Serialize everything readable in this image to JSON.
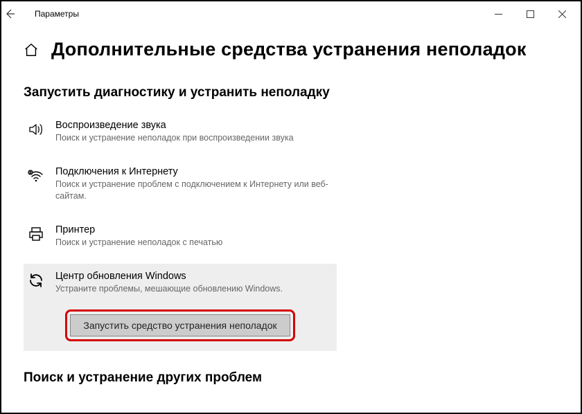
{
  "titlebar": {
    "title": "Параметры"
  },
  "page": {
    "heading": "Дополнительные средства устранения неполадок"
  },
  "sections": {
    "run_diag": "Запустить диагностику и устранить неполадку",
    "other": "Поиск и устранение других проблем"
  },
  "items": {
    "audio": {
      "title": "Воспроизведение звука",
      "desc": "Поиск и устранение неполадок при воспроизведении звука"
    },
    "internet": {
      "title": "Подключения к Интернету",
      "desc": "Поиск и устранение проблем с подключением к Интернету или веб-сайтам."
    },
    "printer": {
      "title": "Принтер",
      "desc": "Поиск и устранение неполадок с печатью"
    },
    "update": {
      "title": "Центр обновления Windows",
      "desc": "Устраните проблемы, мешающие обновлению Windows."
    }
  },
  "buttons": {
    "run": "Запустить средство устранения неполадок"
  }
}
